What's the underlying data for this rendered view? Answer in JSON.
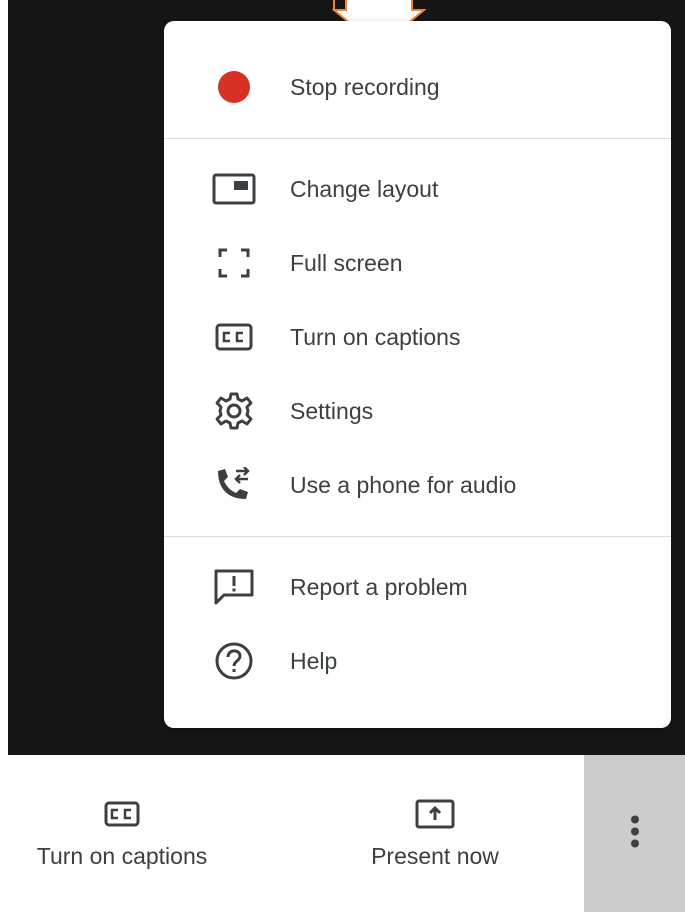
{
  "menu": {
    "items": [
      {
        "label": "Stop recording",
        "icon": "record-dot-icon",
        "color": "#d93025"
      },
      {
        "label": "Change layout",
        "icon": "layout-icon"
      },
      {
        "label": "Full screen",
        "icon": "fullscreen-icon"
      },
      {
        "label": "Turn on captions",
        "icon": "captions-icon"
      },
      {
        "label": "Settings",
        "icon": "gear-icon"
      },
      {
        "label": "Use a phone for audio",
        "icon": "phone-audio-icon"
      },
      {
        "label": "Report a problem",
        "icon": "report-problem-icon"
      },
      {
        "label": "Help",
        "icon": "help-icon"
      }
    ]
  },
  "toolbar": {
    "captions_label": "Turn on captions",
    "present_label": "Present now",
    "more_icon": "more-vertical-icon"
  },
  "colors": {
    "background_dark": "#161616",
    "accent_orange": "#e8873a",
    "record_red": "#d93025",
    "icon_gray": "#3c4043",
    "more_button_bg": "#cccccc"
  }
}
